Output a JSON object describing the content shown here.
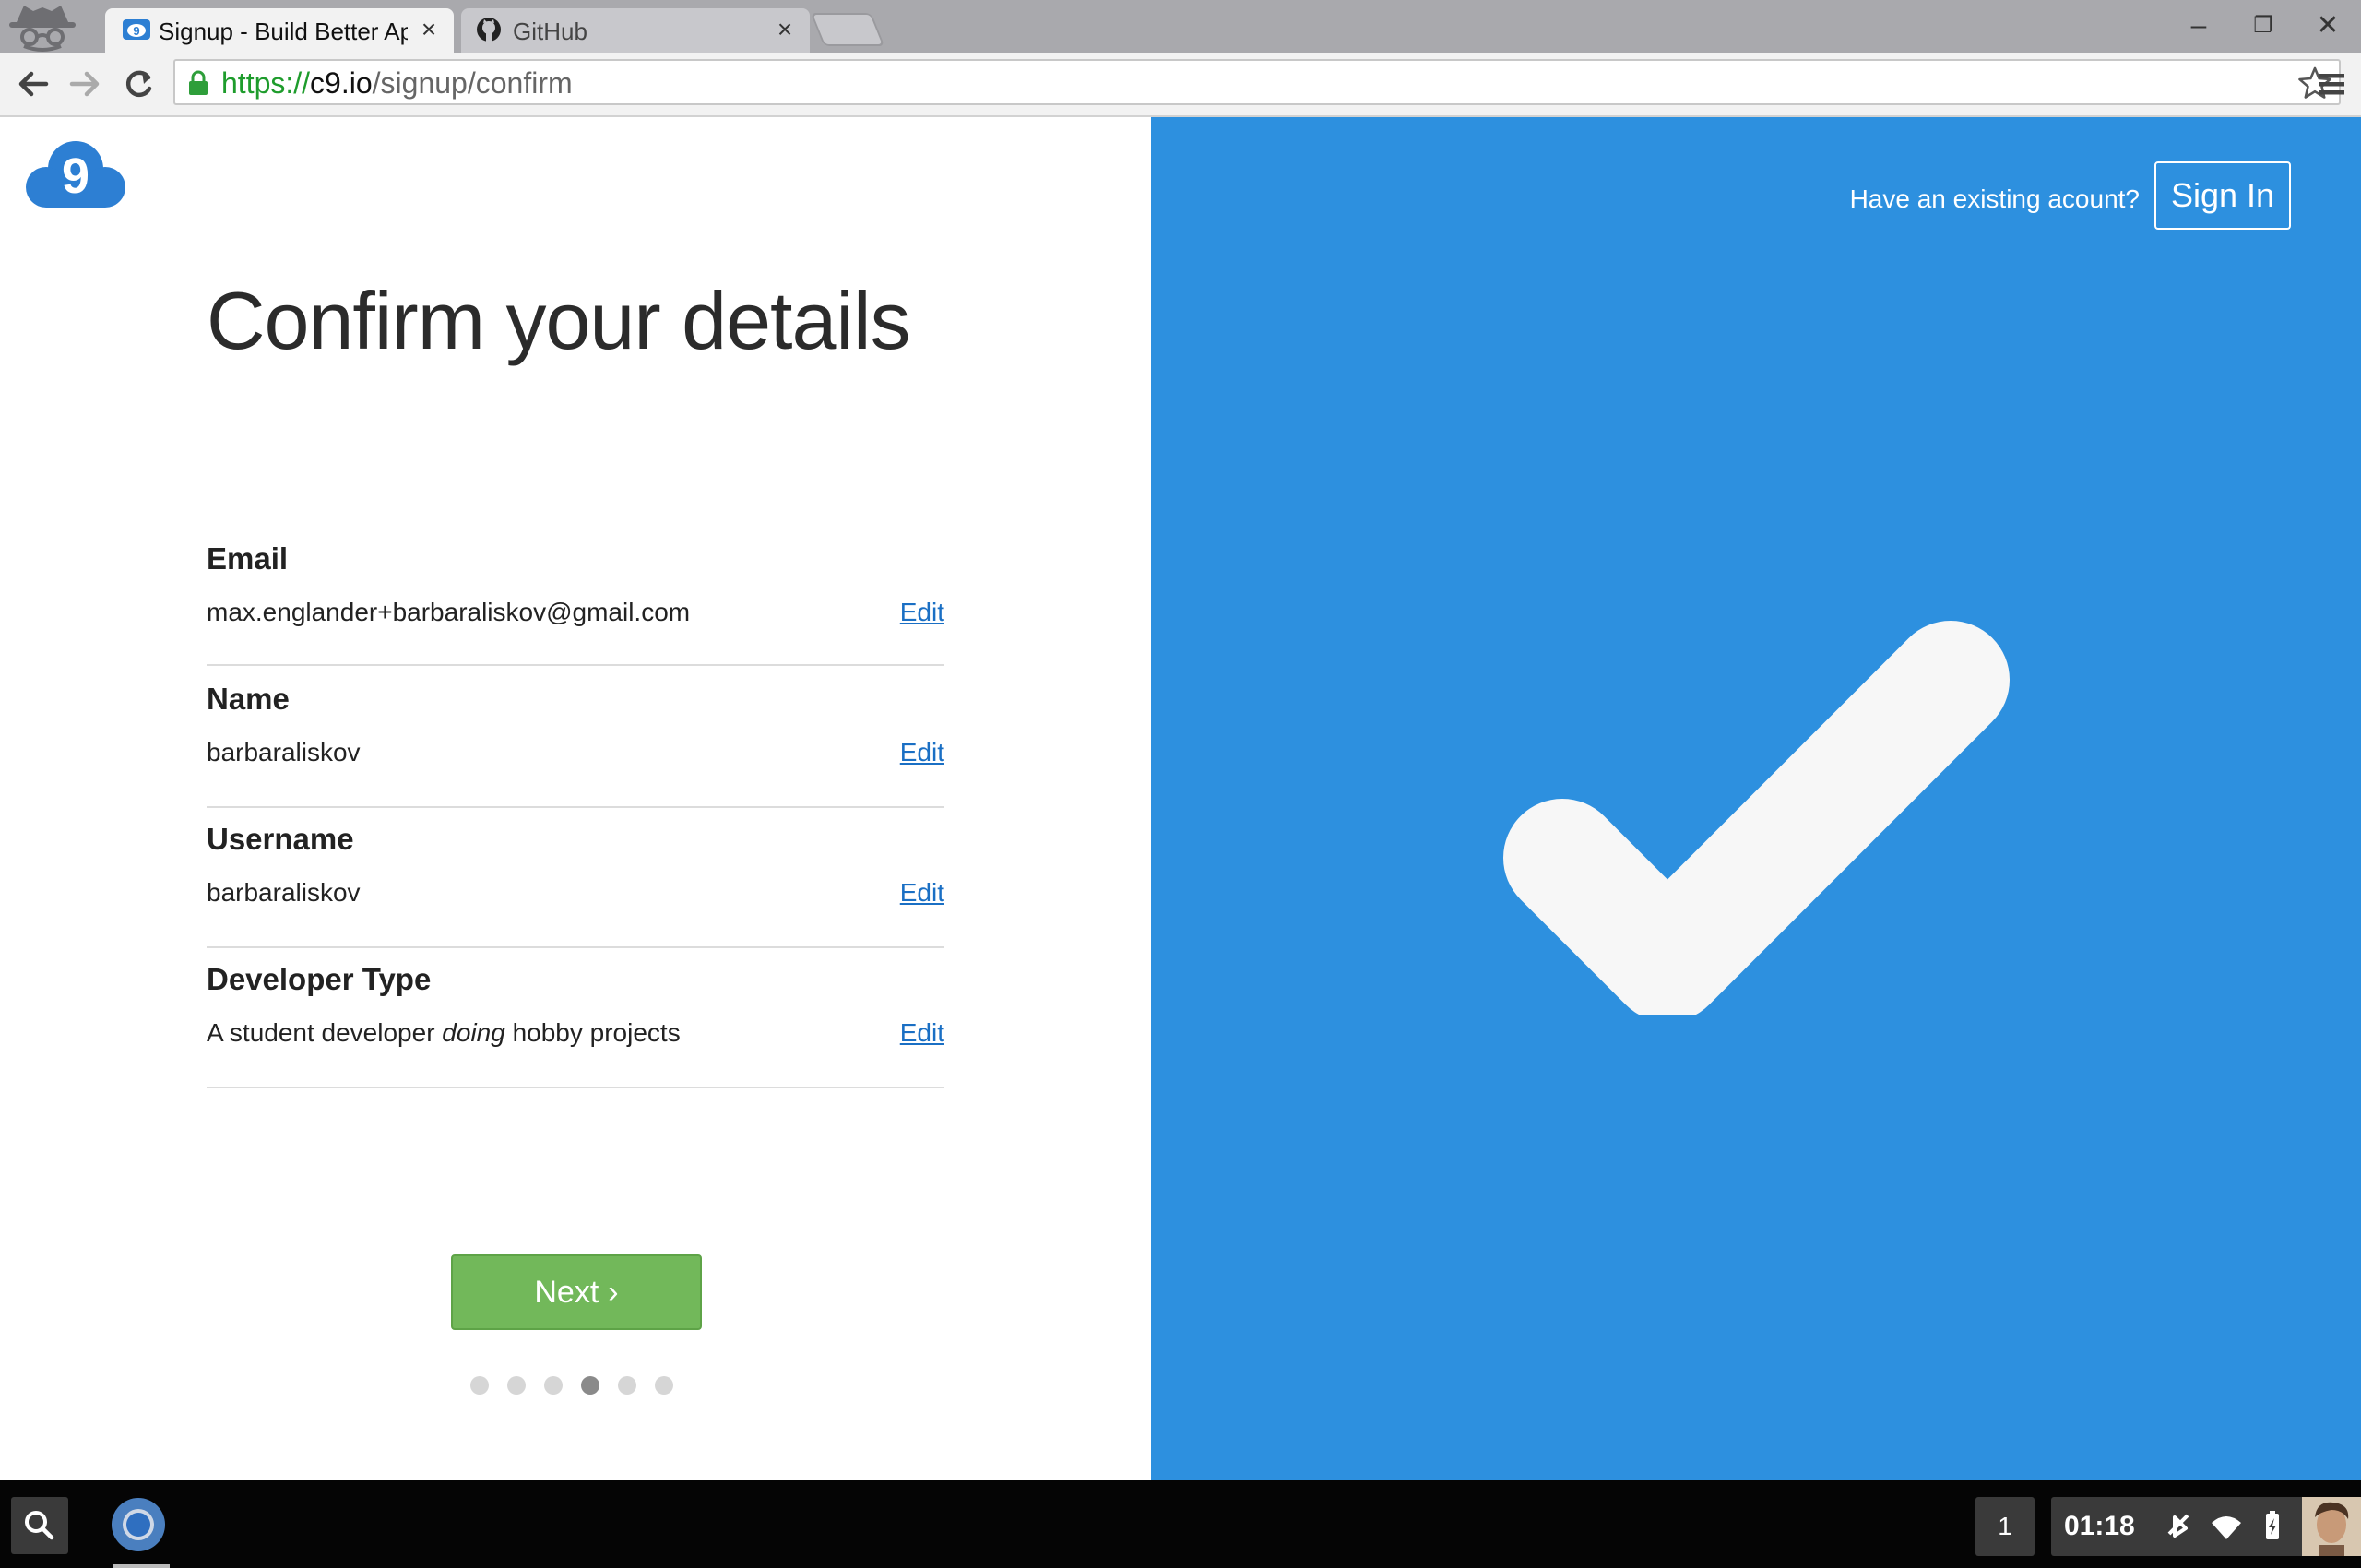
{
  "browser": {
    "tabs": [
      {
        "title": "Signup - Build Better Ap",
        "favicon": "cloud9-icon",
        "active": true
      },
      {
        "title": "GitHub",
        "favicon": "github-icon",
        "active": false
      }
    ],
    "url": {
      "scheme": "https://",
      "host": "c9.io",
      "path": "/signup/confirm"
    },
    "window_controls": {
      "minimize": "–",
      "restore": "❐",
      "close": "✕"
    }
  },
  "page": {
    "logo": "9",
    "heading": "Confirm your details",
    "details": [
      {
        "label": "Email",
        "value": "max.englander+barbaraliskov@gmail.com",
        "edit": "Edit"
      },
      {
        "label": "Name",
        "value": "barbaraliskov",
        "edit": "Edit"
      },
      {
        "label": "Username",
        "value": "barbaraliskov",
        "edit": "Edit"
      },
      {
        "label": "Developer Type",
        "value_pre": "A student developer ",
        "value_em": "doing",
        "value_post": " hobby projects",
        "edit": "Edit"
      }
    ],
    "next_label": "Next",
    "progress": {
      "total_steps": 6,
      "current_step": 4
    },
    "signin_prompt": "Have an existing acount?",
    "signin_label": "Sign In",
    "colors": {
      "brand_blue": "#2d90df",
      "next_green": "#72b85a",
      "link": "#1a6fc4"
    }
  },
  "shelf": {
    "notification_count": "1",
    "clock": "01:18"
  }
}
